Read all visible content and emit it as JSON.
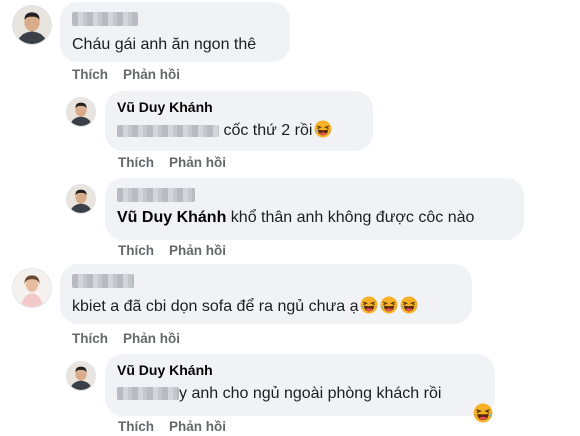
{
  "comments": [
    {
      "id": "c1",
      "author": "",
      "text": "Cháu gái anh ăn ngon thê",
      "actions": {
        "like": "Thích",
        "reply": "Phản hồi"
      }
    },
    {
      "id": "r1",
      "author": "Vũ Duy Khánh",
      "mention": "",
      "text": "cốc thứ 2 rồi",
      "emoji": "laughing-emoji",
      "actions": {
        "like": "Thích",
        "reply": "Phản hồi"
      }
    },
    {
      "id": "r2",
      "author": "",
      "mention": "Vũ Duy Khánh",
      "text": "khổ thân anh không được côc nào",
      "actions": {
        "like": "Thích",
        "reply": "Phản hồi"
      }
    },
    {
      "id": "c2",
      "author": "",
      "text": "kbiet a đã cbi dọn sofa để ra ngủ chưa ạ",
      "emoji": "laughing-emoji",
      "actions": {
        "like": "Thích",
        "reply": "Phản hồi"
      }
    },
    {
      "id": "r3",
      "author": "Vũ Duy Khánh",
      "text": "y anh cho ngủ ngoài phòng khách rồi",
      "emoji": "laughing-emoji",
      "actions": {
        "like": "Thích",
        "reply": "Phản hồi"
      }
    }
  ],
  "colors": {
    "bubble": "#f0f2f5",
    "action_text": "#65676b",
    "emoji_face": "#f7b125"
  }
}
